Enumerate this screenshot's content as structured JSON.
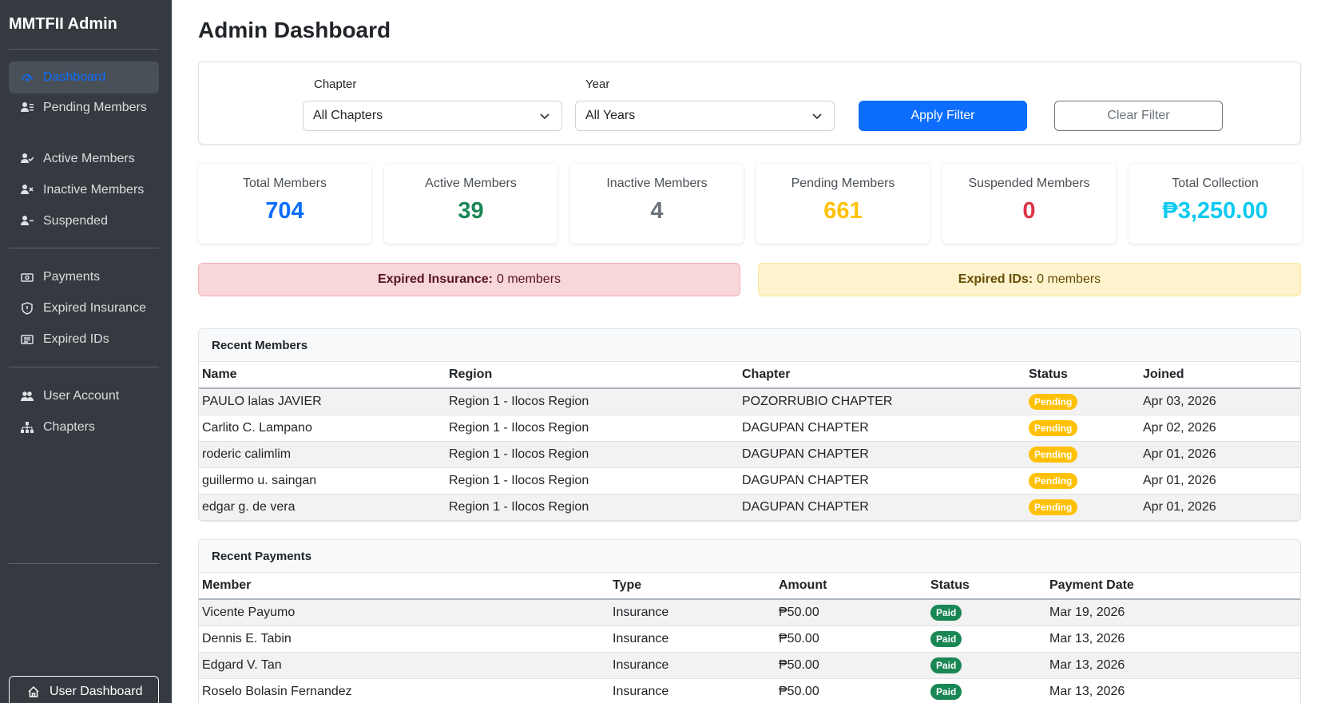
{
  "sidebar": {
    "brand": "MMTFII Admin",
    "items": [
      {
        "label": "Dashboard",
        "icon": "gauge-icon"
      },
      {
        "label": "Pending Members",
        "icon": "user-list-icon"
      },
      {
        "label": "Active Members",
        "icon": "user-check-icon"
      },
      {
        "label": "Inactive Members",
        "icon": "user-x-icon"
      },
      {
        "label": "Suspended",
        "icon": "user-minus-icon"
      },
      {
        "label": "Payments",
        "icon": "cash-icon"
      },
      {
        "label": "Expired Insurance",
        "icon": "shield-icon"
      },
      {
        "label": "Expired IDs",
        "icon": "id-card-icon"
      },
      {
        "label": "User Account",
        "icon": "users-icon"
      },
      {
        "label": "Chapters",
        "icon": "sitemap-icon"
      }
    ],
    "user_dashboard": "User Dashboard"
  },
  "header": {
    "title": "Admin Dashboard"
  },
  "filters": {
    "chapter_label": "Chapter",
    "chapter_value": "All Chapters",
    "year_label": "Year",
    "year_value": "All Years",
    "apply": "Apply Filter",
    "clear": "Clear Filter"
  },
  "stats": [
    {
      "label": "Total Members",
      "value": "704",
      "color": "#0d6efd"
    },
    {
      "label": "Active Members",
      "value": "39",
      "color": "#198754"
    },
    {
      "label": "Inactive Members",
      "value": "4",
      "color": "#6c757d"
    },
    {
      "label": "Pending Members",
      "value": "661",
      "color": "#ffc107"
    },
    {
      "label": "Suspended Members",
      "value": "0",
      "color": "#dc3545"
    },
    {
      "label": "Total Collection",
      "value": "₱3,250.00",
      "color": "#0dcaf0"
    }
  ],
  "alerts": {
    "insurance_label": "Expired Insurance:",
    "insurance_value": "0 members",
    "ids_label": "Expired IDs:",
    "ids_value": "0 members"
  },
  "recent_members": {
    "title": "Recent Members",
    "columns": [
      "Name",
      "Region",
      "Chapter",
      "Status",
      "Joined"
    ],
    "rows": [
      {
        "name": "PAULO lalas JAVIER",
        "region": "Region 1 - Ilocos Region",
        "chapter": "POZORRUBIO CHAPTER",
        "status": "Pending",
        "joined": "Apr 03, 2026"
      },
      {
        "name": "Carlito C. Lampano",
        "region": "Region 1 - Ilocos Region",
        "chapter": "DAGUPAN CHAPTER",
        "status": "Pending",
        "joined": "Apr 02, 2026"
      },
      {
        "name": "roderic calimlim",
        "region": "Region 1 - Ilocos Region",
        "chapter": "DAGUPAN CHAPTER",
        "status": "Pending",
        "joined": "Apr 01, 2026"
      },
      {
        "name": "guillermo u. saingan",
        "region": "Region 1 - Ilocos Region",
        "chapter": "DAGUPAN CHAPTER",
        "status": "Pending",
        "joined": "Apr 01, 2026"
      },
      {
        "name": "edgar g. de vera",
        "region": "Region 1 - Ilocos Region",
        "chapter": "DAGUPAN CHAPTER",
        "status": "Pending",
        "joined": "Apr 01, 2026"
      }
    ]
  },
  "recent_payments": {
    "title": "Recent Payments",
    "columns": [
      "Member",
      "Type",
      "Amount",
      "Status",
      "Payment Date"
    ],
    "rows": [
      {
        "member": "Vicente Payumo",
        "type": "Insurance",
        "amount": "₱50.00",
        "status": "Paid",
        "date": "Mar 19, 2026"
      },
      {
        "member": "Dennis E. Tabin",
        "type": "Insurance",
        "amount": "₱50.00",
        "status": "Paid",
        "date": "Mar 13, 2026"
      },
      {
        "member": "Edgard V. Tan",
        "type": "Insurance",
        "amount": "₱50.00",
        "status": "Paid",
        "date": "Mar 13, 2026"
      },
      {
        "member": "Roselo Bolasin Fernandez",
        "type": "Insurance",
        "amount": "₱50.00",
        "status": "Paid",
        "date": "Mar 13, 2026"
      }
    ]
  }
}
